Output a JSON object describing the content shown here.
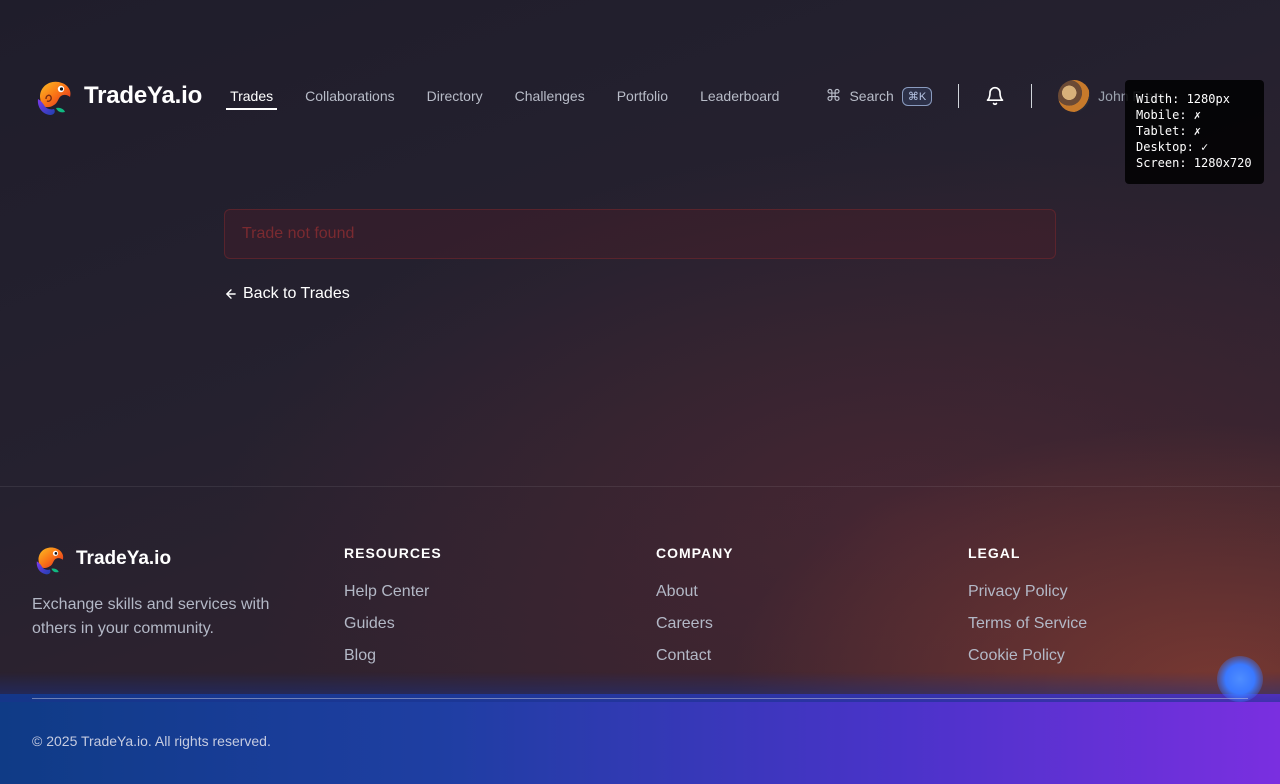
{
  "header": {
    "brand": "TradeYa.io",
    "nav": [
      {
        "label": "Trades",
        "active": true
      },
      {
        "label": "Collaborations"
      },
      {
        "label": "Directory"
      },
      {
        "label": "Challenges"
      },
      {
        "label": "Portfolio"
      },
      {
        "label": "Leaderboard"
      }
    ],
    "search_label": "Search",
    "search_shortcut": "⌘K",
    "user_name": "John Frank"
  },
  "debug_overlay": {
    "width": "Width: 1280px",
    "mobile": "Mobile: ✗",
    "tablet": "Tablet: ✗",
    "desktop": "Desktop: ✓",
    "screen": "Screen: 1280x720"
  },
  "main": {
    "error_message": "Trade not found",
    "back_link": "Back to Trades"
  },
  "footer": {
    "brand": "TradeYa.io",
    "description": "Exchange skills and services with others in your community.",
    "columns": [
      {
        "title": "RESOURCES",
        "links": [
          "Help Center",
          "Guides",
          "Blog"
        ]
      },
      {
        "title": "COMPANY",
        "links": [
          "About",
          "Careers",
          "Contact"
        ]
      },
      {
        "title": "LEGAL",
        "links": [
          "Privacy Policy",
          "Terms of Service",
          "Cookie Policy"
        ]
      }
    ],
    "copyright": "© 2025 TradeYa.io. All rights reserved."
  },
  "colors": {
    "accent_orange": "#f97316",
    "error_text": "#7a2a30",
    "background": "#211f2e"
  }
}
